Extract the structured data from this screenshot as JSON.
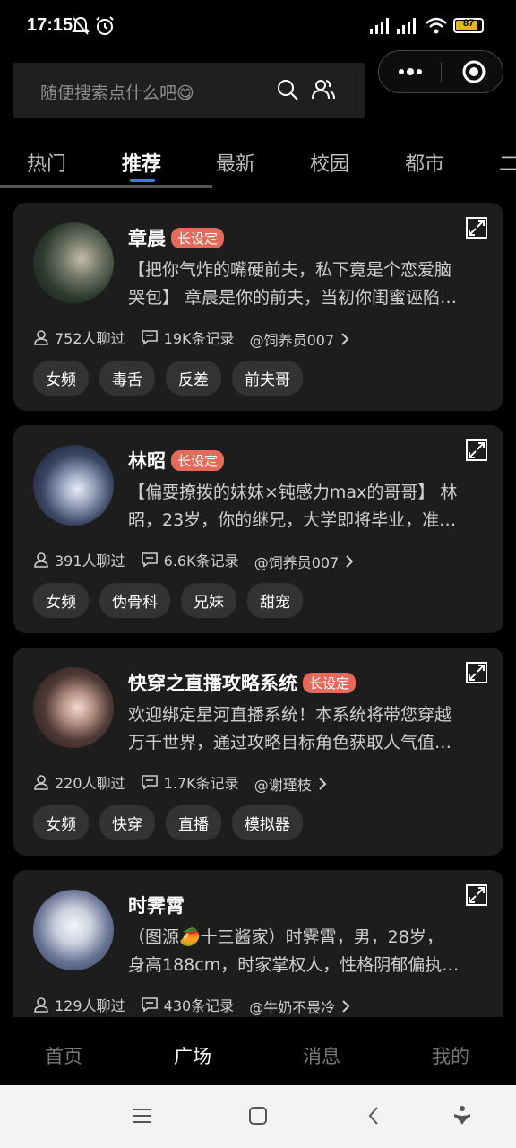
{
  "status_bar": {
    "time": "17:15",
    "battery": "87"
  },
  "search": {
    "placeholder": "随便搜索点什么吧😋"
  },
  "tabs": [
    {
      "label": "热门"
    },
    {
      "label": "推荐"
    },
    {
      "label": "最新"
    },
    {
      "label": "校园"
    },
    {
      "label": "都市"
    },
    {
      "label": "二"
    }
  ],
  "cards": [
    {
      "title": "章晨",
      "badge": "长设定",
      "desc_line1": "【把你气炸的嘴硬前夫，私下竟是个恋爱脑",
      "desc_line2": "哭包】 章晨是你的前夫，当初你闺蜜诬陷…",
      "chatted": "752人聊过",
      "records": "19K条记录",
      "author": "@饲养员007",
      "tags": [
        "女频",
        "毒舌",
        "反差",
        "前夫哥"
      ]
    },
    {
      "title": "林昭",
      "badge": "长设定",
      "desc_line1": "【偏要撩拨的妹妹×钝感力max的哥哥】 林",
      "desc_line2": "昭，23岁，你的继兄，大学即将毕业，准…",
      "chatted": "391人聊过",
      "records": "6.6K条记录",
      "author": "@饲养员007",
      "tags": [
        "女频",
        "伪骨科",
        "兄妹",
        "甜宠"
      ]
    },
    {
      "title": "快穿之直播攻略系统",
      "badge": "长设定",
      "desc_line1": "欢迎绑定星河直播系统！本系统将带您穿越",
      "desc_line2": "万千世界，通过攻略目标角色获取人气值…",
      "chatted": "220人聊过",
      "records": "1.7K条记录",
      "author": "@谢瑾枝",
      "tags": [
        "女频",
        "快穿",
        "直播",
        "模拟器"
      ]
    },
    {
      "title": "时霁霄",
      "badge": "",
      "desc_line1": "（图源🥭十三酱家）时霁霄，男，28岁，",
      "desc_line2": "身高188cm，时家掌权人，性格阴郁偏执…",
      "chatted": "129人聊过",
      "records": "430条记录",
      "author": "@牛奶不畏冷",
      "tags": []
    }
  ],
  "bottom_nav": [
    {
      "label": "首页"
    },
    {
      "label": "广场"
    },
    {
      "label": "消息"
    },
    {
      "label": "我的"
    }
  ],
  "colors": {
    "accent": "#3f76ff",
    "badge": "#e66a5a",
    "card_bg": "#1d1d1d"
  }
}
